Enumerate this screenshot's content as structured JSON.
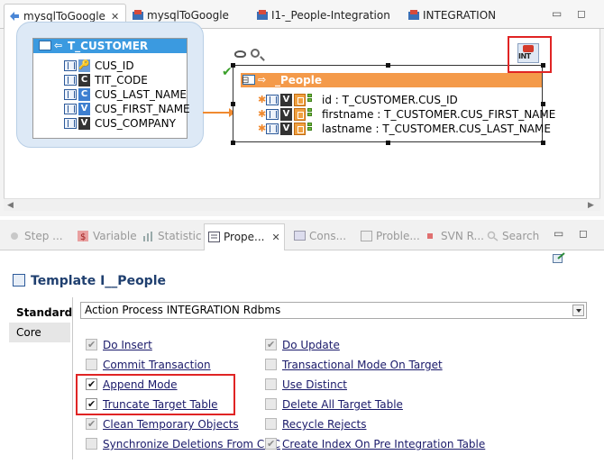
{
  "editor_tabs": [
    {
      "label": "mysqlToGoogle",
      "active": true
    },
    {
      "label": "mysqlToGoogle",
      "active": false
    },
    {
      "label": "I1-_People-Integration",
      "active": false
    },
    {
      "label": "INTEGRATION",
      "active": false
    }
  ],
  "diagram": {
    "source": {
      "title": "T_CUSTOMER",
      "columns": [
        {
          "name": "CUS_ID",
          "badge": "key"
        },
        {
          "name": "TIT_CODE",
          "badge": "C"
        },
        {
          "name": "CUS_LAST_NAME",
          "badge": "C"
        },
        {
          "name": "CUS_FIRST_NAME",
          "badge": "V"
        },
        {
          "name": "CUS_COMPANY",
          "badge": "V"
        }
      ]
    },
    "target": {
      "title": "_People",
      "mappings": [
        {
          "expr": "id : T_CUSTOMER.CUS_ID"
        },
        {
          "expr": "firstname : T_CUSTOMER.CUS_FIRST_NAME"
        },
        {
          "expr": "lastname : T_CUSTOMER.CUS_LAST_NAME"
        }
      ]
    },
    "int_icon_label": "INT"
  },
  "view_tabs": [
    {
      "label": "Step ..."
    },
    {
      "label": "Variable"
    },
    {
      "label": "Statistic"
    },
    {
      "label": "Prope...",
      "active": true
    },
    {
      "label": "Cons..."
    },
    {
      "label": "Proble..."
    },
    {
      "label": "SVN R..."
    },
    {
      "label": "Search"
    }
  ],
  "properties": {
    "title": "Template I__People",
    "side_tabs": [
      "Standard",
      "Core"
    ],
    "process_select": "Action Process INTEGRATION Rdbms",
    "options_left": [
      {
        "label": "Do Insert",
        "checked": true,
        "enabled": false
      },
      {
        "label": "Commit Transaction",
        "checked": false,
        "enabled": false
      },
      {
        "label": "Append Mode",
        "checked": true,
        "enabled": true
      },
      {
        "label": "Truncate Target Table",
        "checked": true,
        "enabled": true
      },
      {
        "label": "Clean Temporary Objects",
        "checked": true,
        "enabled": false
      },
      {
        "label": "Synchronize Deletions From CDC",
        "checked": false,
        "enabled": false
      }
    ],
    "options_right": [
      {
        "label": "Do Update",
        "checked": true,
        "enabled": false
      },
      {
        "label": "Transactional Mode On Target",
        "checked": false,
        "enabled": false
      },
      {
        "label": "Use Distinct",
        "checked": false,
        "enabled": false
      },
      {
        "label": "Delete All Target Table",
        "checked": false,
        "enabled": false
      },
      {
        "label": "Recycle Rejects",
        "checked": false,
        "enabled": false
      },
      {
        "label": "Create Index On Pre Integration Table",
        "checked": true,
        "enabled": false
      }
    ]
  },
  "colors": {
    "source_header": "#3b9ae0",
    "target_header": "#f49a4a",
    "highlight_box": "#e02424"
  }
}
